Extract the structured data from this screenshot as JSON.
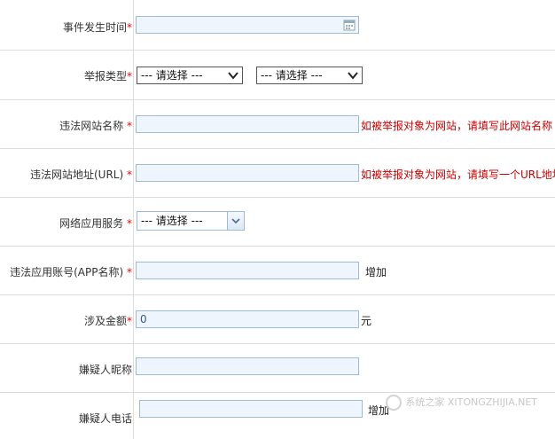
{
  "form": {
    "event_time": {
      "label": "事件发生时间",
      "required_mark": "*"
    },
    "report_type": {
      "label": "举报类型",
      "required_mark": "*",
      "select1_value": "--- 请选择 ---",
      "select2_value": "--- 请选择 ---"
    },
    "site_name": {
      "label": "违法网站名称",
      "required_mark": "*",
      "hint": "如被举报对象为网站，请填写此网站名称"
    },
    "site_url": {
      "label": "违法网站地址(URL)",
      "required_mark": "*",
      "hint": "如被举报对象为网站，请填写一个URL地址"
    },
    "app_service": {
      "label": "网络应用服务",
      "required_mark": "*",
      "select_value": "--- 请选择 ---"
    },
    "app_account": {
      "label": "违法应用账号(APP名称)",
      "required_mark": "*",
      "add_label": "增加"
    },
    "amount": {
      "label": "涉及金额",
      "required_mark": "*",
      "value": "0",
      "unit": "元"
    },
    "suspect_nickname": {
      "label": "嫌疑人昵称"
    },
    "suspect_phone": {
      "label": "嫌疑人电话",
      "add_label": "增加"
    }
  },
  "watermark": {
    "text": "系统之家 XITONGZHIJIA.NET",
    "icon": "logo-icon"
  },
  "colors": {
    "required": "#e00000",
    "hint": "#cc0000",
    "field_border": "#9dbad6",
    "field_bg": "#eef5fc"
  }
}
